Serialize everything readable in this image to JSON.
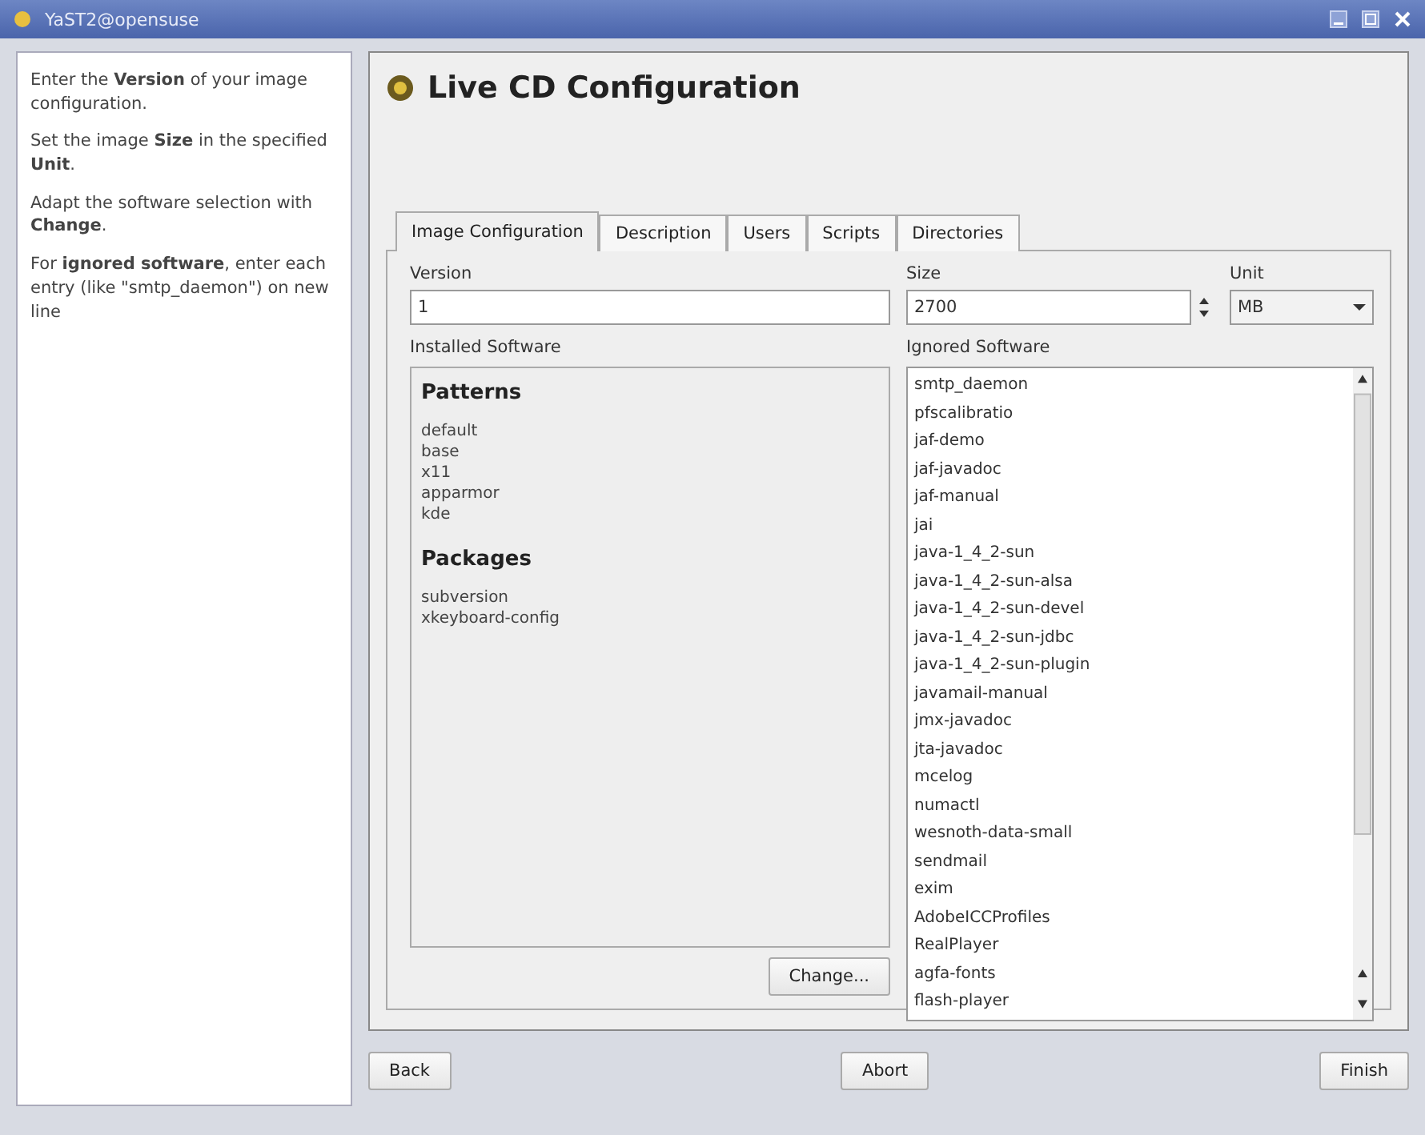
{
  "window": {
    "title": "YaST2@opensuse"
  },
  "help": [
    "Enter the **Version** of your image configuration.",
    "Set the image **Size** in the specified **Unit**.",
    "Adapt the software selection with **Change**.",
    "For **ignored software**, enter each entry (like \"smtp_daemon\") on new line"
  ],
  "heading": "Live CD Configuration",
  "tabs": [
    {
      "label": "Image Configuration",
      "selected": true
    },
    {
      "label": "Description",
      "selected": false
    },
    {
      "label": "Users",
      "selected": false
    },
    {
      "label": "Scripts",
      "selected": false
    },
    {
      "label": "Directories",
      "selected": false
    }
  ],
  "version": {
    "label": "Version",
    "value": "1"
  },
  "size": {
    "label": "Size",
    "value": "2700"
  },
  "unit": {
    "label": "Unit",
    "value": "MB"
  },
  "installed": {
    "label": "Installed Software",
    "sections": [
      {
        "title": "Patterns",
        "items": [
          "default",
          "base",
          "x11",
          "apparmor",
          "kde"
        ]
      },
      {
        "title": "Packages",
        "items": [
          "subversion",
          "xkeyboard-config"
        ]
      }
    ],
    "button": "Change..."
  },
  "ignored": {
    "label": "Ignored Software",
    "items": [
      "smtp_daemon",
      "pfscalibratio",
      "jaf-demo",
      "jaf-javadoc",
      "jaf-manual",
      "jai",
      "java-1_4_2-sun",
      "java-1_4_2-sun-alsa",
      "java-1_4_2-sun-devel",
      "java-1_4_2-sun-jdbc",
      "java-1_4_2-sun-plugin",
      "javamail-manual",
      "jmx-javadoc",
      "jta-javadoc",
      "mcelog",
      "numactl",
      "wesnoth-data-small",
      "sendmail",
      "exim",
      "AdobeICCProfiles",
      "RealPlayer",
      "agfa-fonts",
      "flash-player"
    ]
  },
  "buttons": {
    "back": "Back",
    "abort": "Abort",
    "finish": "Finish"
  }
}
